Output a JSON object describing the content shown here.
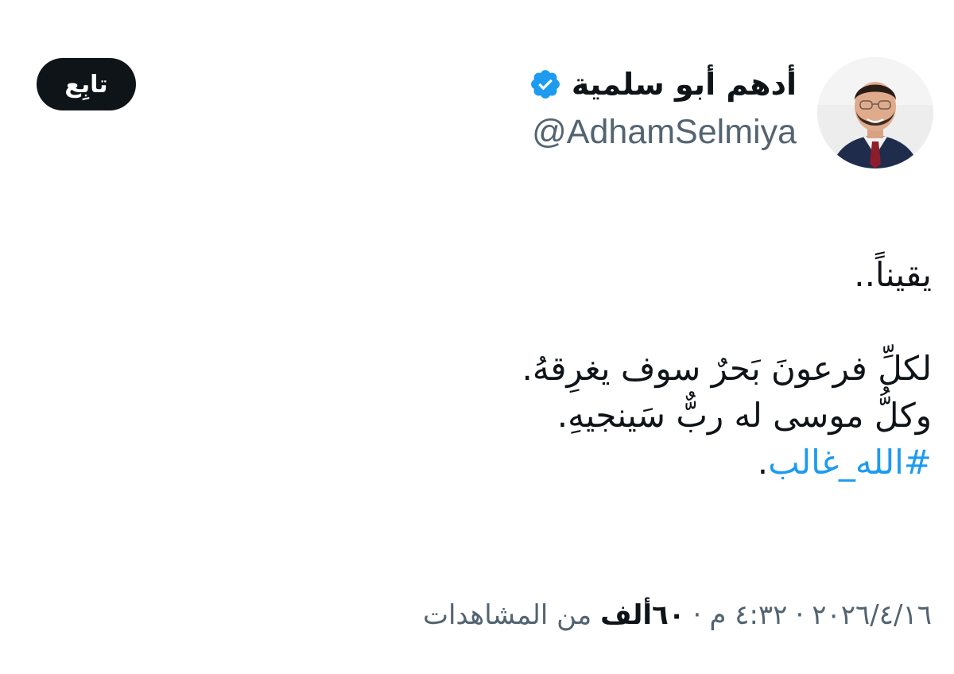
{
  "author": {
    "display_name": "أدهم أبو سلمية",
    "handle": "@AdhamSelmiya",
    "verified_color": "#1d9bf0"
  },
  "follow_label": "تابِع",
  "tweet": {
    "lines": [
      "يقيناً..",
      "",
      "لكلِّ فرعونَ بَحرٌ سوف يغرِقهُ.",
      "وكلُّ موسى له ربٌّ سَينجيهِ."
    ],
    "hashtag": "#الله_غالب",
    "hashtag_suffix": "."
  },
  "meta": {
    "time": "٤:٣٢ م",
    "date": "٢٠٢٦/٤/١٦",
    "separator": "·",
    "views_count": "٦٠ألف",
    "views_label": "من المشاهدات"
  },
  "colors": {
    "link": "#1d9bf0",
    "secondary_text": "#536471",
    "button_bg": "#0f1419"
  },
  "icons": {
    "verified": "verified-badge-icon",
    "avatar": "profile-photo"
  }
}
